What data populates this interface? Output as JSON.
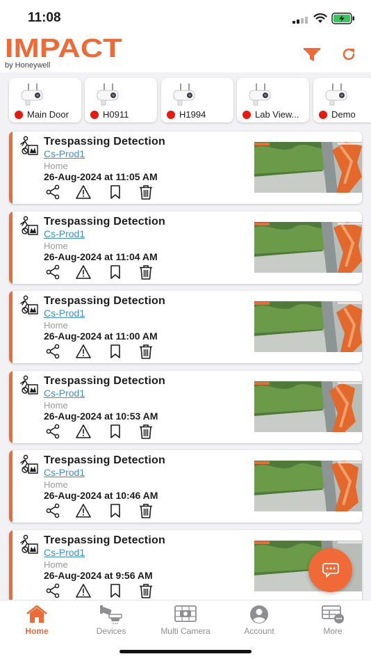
{
  "status_bar": {
    "time": "11:08"
  },
  "header": {
    "brand": "IMPACT",
    "brand_sub": "by Honeywell"
  },
  "cameras": [
    {
      "name": "Main Door",
      "status_color": "#e8190f"
    },
    {
      "name": "H0911",
      "status_color": "#e8190f"
    },
    {
      "name": "H1994",
      "status_color": "#e8190f"
    },
    {
      "name": "Lab View...",
      "status_color": "#e8190f"
    },
    {
      "name": "Demo",
      "status_color": "#e8190f"
    }
  ],
  "events": [
    {
      "title": "Trespassing Detection",
      "site": "Cs-Prod1",
      "location": "Home",
      "time": "26-Aug-2024 at 11:05 AM"
    },
    {
      "title": "Trespassing Detection",
      "site": "Cs-Prod1",
      "location": "Home",
      "time": "26-Aug-2024 at 11:04 AM"
    },
    {
      "title": "Trespassing Detection",
      "site": "Cs-Prod1",
      "location": "Home",
      "time": "26-Aug-2024 at 11:00 AM"
    },
    {
      "title": "Trespassing Detection",
      "site": "Cs-Prod1",
      "location": "Home",
      "time": "26-Aug-2024 at 10:53 AM"
    },
    {
      "title": "Trespassing Detection",
      "site": "Cs-Prod1",
      "location": "Home",
      "time": "26-Aug-2024 at 10:46 AM"
    },
    {
      "title": "Trespassing Detection",
      "site": "Cs-Prod1",
      "location": "Home",
      "time": "26-Aug-2024 at 9:56 AM"
    }
  ],
  "tabs": [
    {
      "label": "Home",
      "icon": "home-icon",
      "active": true
    },
    {
      "label": "Devices",
      "icon": "devices-icon",
      "active": false
    },
    {
      "label": "Multi Camera",
      "icon": "multi-camera-icon",
      "active": false
    },
    {
      "label": "Account",
      "icon": "account-icon",
      "active": false
    },
    {
      "label": "More",
      "icon": "more-icon",
      "active": false
    }
  ],
  "colors": {
    "accent": "#ef6a36",
    "link": "#3a8de0",
    "offline": "#e8190f"
  }
}
